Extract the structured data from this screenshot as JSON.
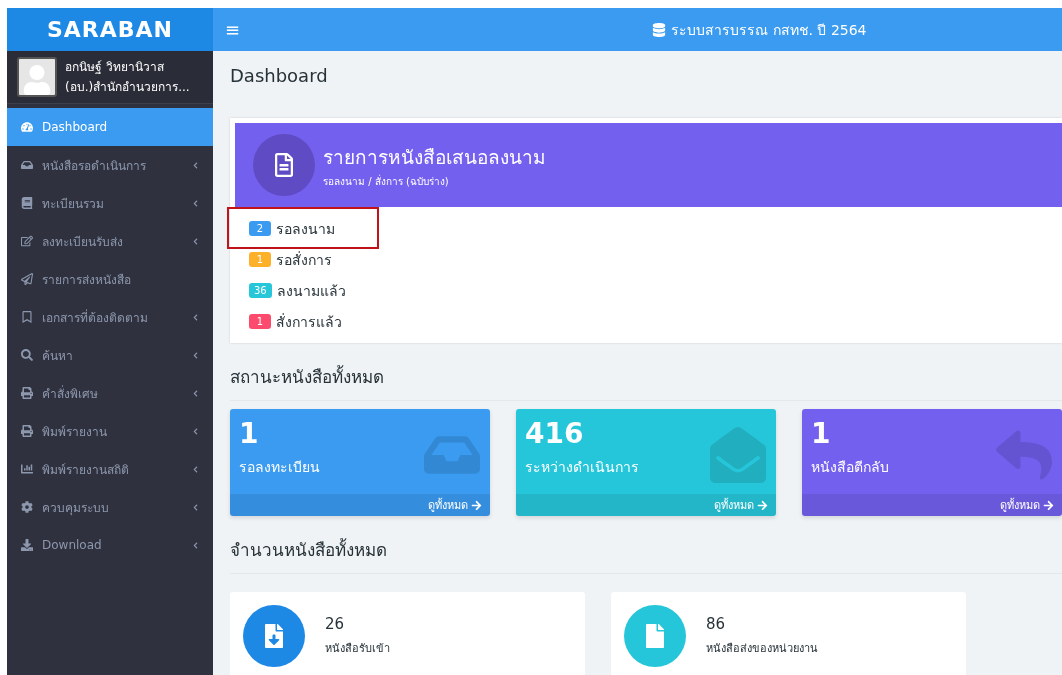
{
  "sidebar": {
    "logo": "SARABAN",
    "user": {
      "name": "อกนิษฐ์ วิทยานิวาส",
      "unit": "(อบ.)สำนักอำนวยการ..."
    },
    "items": [
      {
        "kind": "gauge",
        "label": "Dashboard",
        "selected": true,
        "submenu": false
      },
      {
        "kind": "inbox",
        "label": "หนังสือรอดำเนินการ",
        "selected": false,
        "submenu": true
      },
      {
        "kind": "book",
        "label": "ทะเบียนรวม",
        "selected": false,
        "submenu": true
      },
      {
        "kind": "edit",
        "label": "ลงทะเบียนรับส่ง",
        "selected": false,
        "submenu": true
      },
      {
        "kind": "send",
        "label": "รายการส่งหนังสือ",
        "selected": false,
        "submenu": false
      },
      {
        "kind": "bookmark",
        "label": "เอกสารที่ต้องติดตาม",
        "selected": false,
        "submenu": true
      },
      {
        "kind": "search",
        "label": "ค้นหา",
        "selected": false,
        "submenu": true
      },
      {
        "kind": "print",
        "label": "คำสั่งพิเศษ",
        "selected": false,
        "submenu": true
      },
      {
        "kind": "print",
        "label": "พิมพ์รายงาน",
        "selected": false,
        "submenu": true
      },
      {
        "kind": "chart",
        "label": "พิมพ์รายงานสถิติ",
        "selected": false,
        "submenu": true
      },
      {
        "kind": "gear",
        "label": "ควบคุมระบบ",
        "selected": false,
        "submenu": true
      },
      {
        "kind": "download",
        "label": "Download",
        "selected": false,
        "submenu": true
      }
    ]
  },
  "header": {
    "menu_glyph": "≡",
    "title": "ระบบสารบรรณ กสทช. ปี 2564"
  },
  "page_title": "Dashboard",
  "sign_panel": {
    "title": "รายการหนังสือเสนอลงนาม",
    "subtitle": "รอลงนาม / สั่งการ (ฉบับร่าง)",
    "items": [
      {
        "count": "2",
        "label": "รอลงนาม",
        "color": "#3a9bf0",
        "highlighted": true
      },
      {
        "count": "1",
        "label": "รอสั่งการ",
        "color": "#fdb12b",
        "highlighted": false
      },
      {
        "count": "36",
        "label": "ลงนามแล้ว",
        "color": "#27c6d8",
        "highlighted": false
      },
      {
        "count": "1",
        "label": "สั่งการแล้ว",
        "color": "#fc4b6c",
        "highlighted": false
      }
    ]
  },
  "status_heading": "สถานะหนังสือทั้งหมด",
  "status_cards": [
    {
      "kind": "inbox",
      "count": "1",
      "label": "รอลงทะเบียน",
      "link": "ดูทั้งหมด",
      "color": "#3a9bf0"
    },
    {
      "kind": "envelope",
      "count": "416",
      "label": "ระหว่างดำเนินการ",
      "link": "ดูทั้งหมด",
      "color": "#26c6da"
    },
    {
      "kind": "reply",
      "count": "1",
      "label": "หนังสือตีกลับ",
      "link": "ดูทั้งหมด",
      "color": "#7460ee"
    }
  ],
  "total_heading": "จำนวนหนังสือทั้งหมด",
  "totals": [
    {
      "kind": "incoming",
      "count": "26",
      "label": "หนังสือรับเข้า",
      "color": "#1e88e5"
    },
    {
      "kind": "file",
      "count": "86",
      "label": "หนังสือส่งของหน่วยงาน",
      "color": "#26c6da"
    }
  ]
}
